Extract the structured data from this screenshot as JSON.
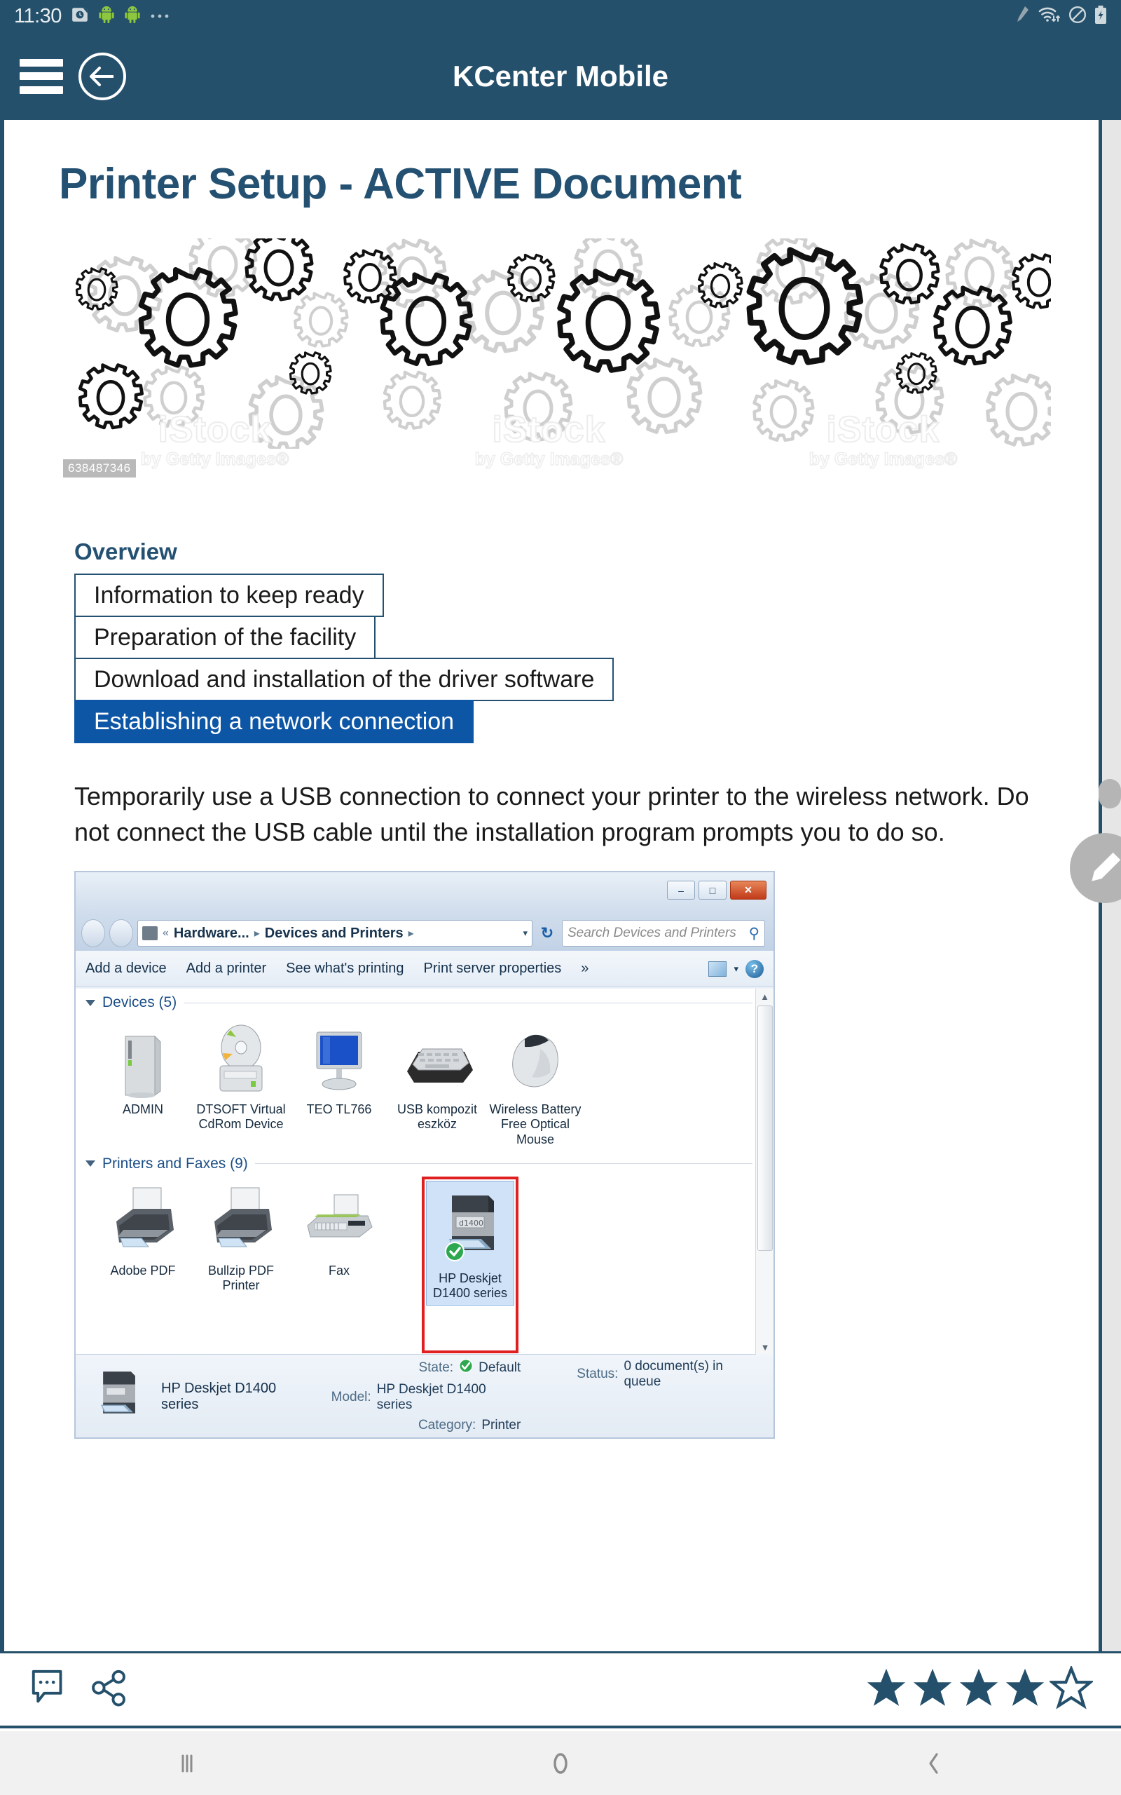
{
  "statusbar": {
    "clock": "11:30",
    "left_icons": [
      "alarm-clock-icon",
      "android-robot-icon",
      "android-robot-icon",
      "more-dots-icon"
    ],
    "right_icons": [
      "stylus-pen-icon",
      "wifi-transfer-icon",
      "do-not-disturb-icon",
      "battery-charging-icon"
    ]
  },
  "appbar": {
    "title": "KCenter Mobile",
    "menu_icon": "hamburger-menu-icon",
    "back_icon": "back-arrow-circle-icon"
  },
  "document": {
    "title": "Printer Setup - ACTIVE Document",
    "banner": {
      "alt": "gears illustration banner",
      "watermark_top": "iStock",
      "watermark_bottom": "by Getty Images®",
      "watermark_id": "638487346"
    },
    "overview": {
      "heading": "Overview",
      "items": [
        {
          "label": "Information to keep ready",
          "active": false
        },
        {
          "label": "Preparation of the facility",
          "active": false
        },
        {
          "label": "Download and installation of the driver software",
          "active": false
        },
        {
          "label": "Establishing a network connection",
          "active": true
        }
      ]
    },
    "paragraph": "Temporarily use a USB connection to connect your printer to the wireless network. Do not connect the USB cable until the installation program prompts you to do so."
  },
  "winshot": {
    "window_buttons": {
      "minimize": "–",
      "maximize": "□",
      "close": "✕"
    },
    "address": {
      "back_forward": "nav-circles-icon",
      "chevrons": "«",
      "crumb1": "Hardware...",
      "crumb2": "Devices and Printers",
      "separator": "▸",
      "dropdown": "▾",
      "refresh": "↻"
    },
    "search_placeholder": "Search Devices and Printers",
    "toolbar": [
      "Add a device",
      "Add a printer",
      "See what's printing",
      "Print server properties",
      "»"
    ],
    "groups": [
      {
        "title": "Devices (5)",
        "items": [
          {
            "label": "ADMIN",
            "icon": "computer-tower-icon"
          },
          {
            "label": "DTSOFT Virtual CdRom Device",
            "icon": "cdrom-drive-icon"
          },
          {
            "label": "TEO TL766",
            "icon": "monitor-icon"
          },
          {
            "label": "USB kompozit eszköz",
            "icon": "keyboard-icon"
          },
          {
            "label": "Wireless Battery Free Optical Mouse",
            "icon": "mouse-icon"
          }
        ]
      },
      {
        "title": "Printers and Faxes (9)",
        "items": [
          {
            "label": "Adobe PDF",
            "icon": "printer-icon",
            "selected": false
          },
          {
            "label": "Bullzip PDF Printer",
            "icon": "printer-icon",
            "selected": false
          },
          {
            "label": "Fax",
            "icon": "fax-icon",
            "selected": false
          },
          {
            "label": "HP Deskjet D1400 series",
            "icon": "printer-default-icon",
            "selected": true
          }
        ]
      }
    ],
    "details": {
      "name": "HP Deskjet D1400 series",
      "state_label": "State:",
      "state_value": "Default",
      "model_label": "Model:",
      "model_value": "HP Deskjet D1400 series",
      "category_label": "Category:",
      "category_value": "Printer",
      "status_label": "Status:",
      "status_value": "0 document(s) in queue"
    }
  },
  "actionbar": {
    "comment_icon": "comment-bubble-icon",
    "share_icon": "share-nodes-icon",
    "rating": 4,
    "rating_max": 5
  },
  "navbar": {
    "recents": "|||",
    "home": "◯",
    "back": "‹"
  },
  "fab": {
    "icon": "edit-pencil-icon"
  },
  "colors": {
    "header": "#24506b",
    "accent_blue": "#0d56a6",
    "title_text": "#245172",
    "selection_red": "#e02020"
  }
}
